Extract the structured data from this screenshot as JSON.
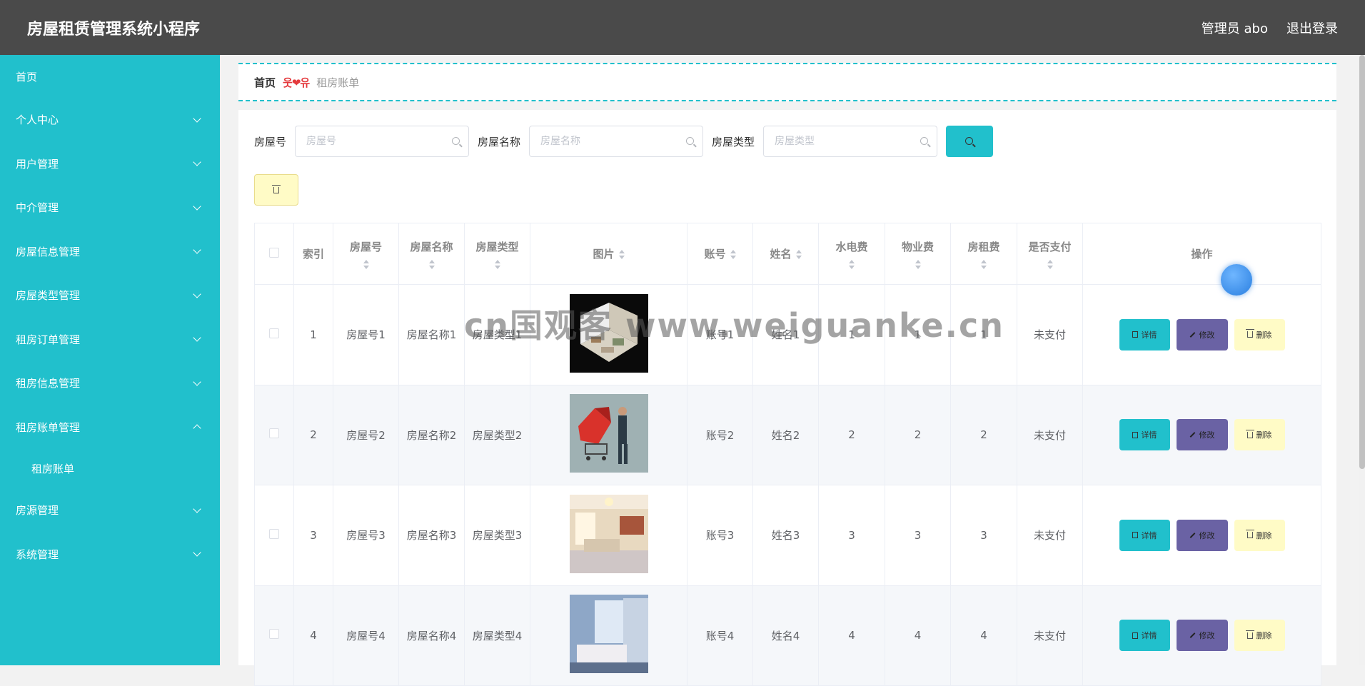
{
  "header": {
    "title": "房屋租赁管理系统小程序",
    "admin": "管理员 abo",
    "logout": "退出登录"
  },
  "sidebar": {
    "items": [
      {
        "label": "首页"
      },
      {
        "label": "个人中心"
      },
      {
        "label": "用户管理"
      },
      {
        "label": "中介管理"
      },
      {
        "label": "房屋信息管理"
      },
      {
        "label": "房屋类型管理"
      },
      {
        "label": "租房订单管理"
      },
      {
        "label": "租房信息管理"
      },
      {
        "label": "租房账单管理"
      },
      {
        "label": "租房账单"
      },
      {
        "label": "房源管理"
      },
      {
        "label": "系统管理"
      }
    ]
  },
  "breadcrumb": {
    "home": "首页",
    "separator": "웃❤유",
    "current": "租房账单"
  },
  "search": {
    "house_no_label": "房屋号",
    "house_no_placeholder": "房屋号",
    "house_name_label": "房屋名称",
    "house_name_placeholder": "房屋名称",
    "house_type_label": "房屋类型",
    "house_type_placeholder": "房屋类型"
  },
  "table": {
    "headers": [
      "索引",
      "房屋号",
      "房屋名称",
      "房屋类型",
      "图片",
      "账号",
      "姓名",
      "水电费",
      "物业费",
      "房租费",
      "是否支付",
      "操作"
    ],
    "actions": {
      "detail": "详情",
      "edit": "修改",
      "delete": "删除"
    },
    "rows": [
      {
        "index": "1",
        "house_no": "房屋号1",
        "house_name": "房屋名称1",
        "house_type": "房屋类型1",
        "account": "账号1",
        "name": "姓名1",
        "utility": "1",
        "property": "1",
        "rent": "1",
        "paid": "未支付"
      },
      {
        "index": "2",
        "house_no": "房屋号2",
        "house_name": "房屋名称2",
        "house_type": "房屋类型2",
        "account": "账号2",
        "name": "姓名2",
        "utility": "2",
        "property": "2",
        "rent": "2",
        "paid": "未支付"
      },
      {
        "index": "3",
        "house_no": "房屋号3",
        "house_name": "房屋名称3",
        "house_type": "房屋类型3",
        "account": "账号3",
        "name": "姓名3",
        "utility": "3",
        "property": "3",
        "rent": "3",
        "paid": "未支付"
      },
      {
        "index": "4",
        "house_no": "房屋号4",
        "house_name": "房屋名称4",
        "house_type": "房屋类型4",
        "account": "账号4",
        "name": "姓名4",
        "utility": "4",
        "property": "4",
        "rent": "4",
        "paid": "未支付"
      }
    ]
  },
  "watermark": "cn国观客 www.weiguanke.cn",
  "colors": {
    "accent": "#21c0cc",
    "header": "#4a4a4a",
    "edit": "#6a62a4",
    "delete": "#fffbc6"
  }
}
